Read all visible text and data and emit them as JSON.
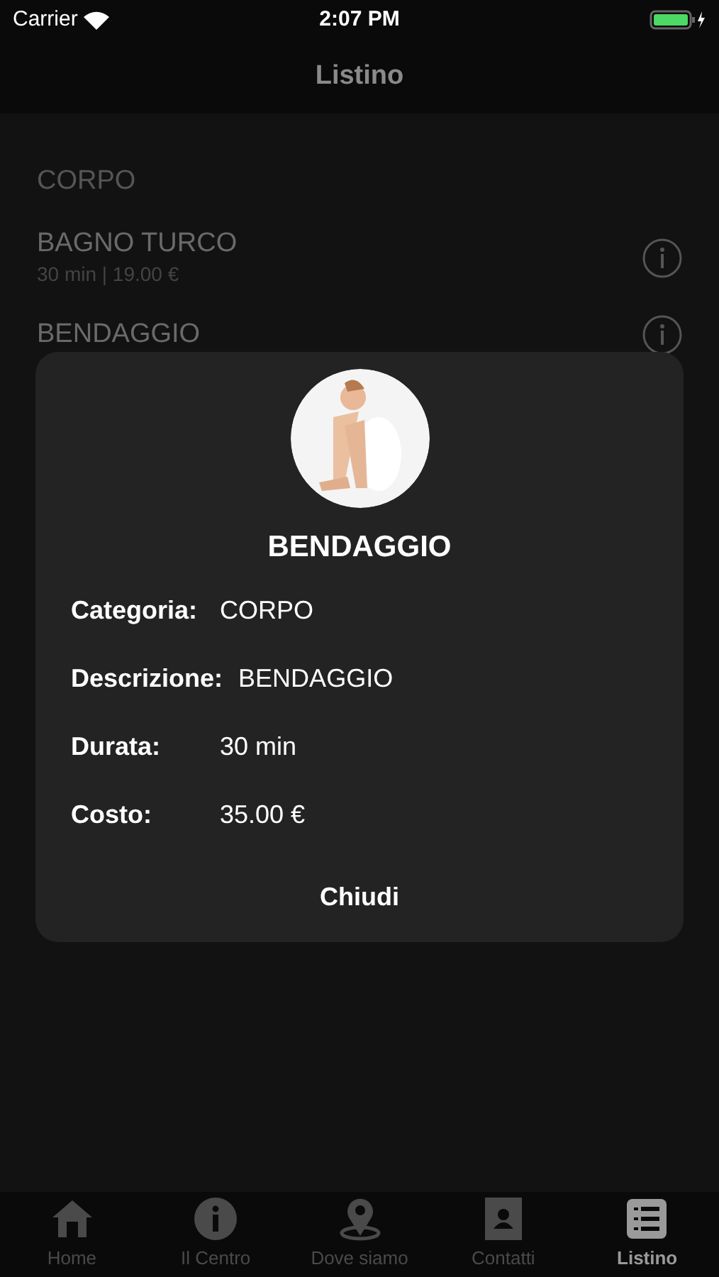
{
  "status_bar": {
    "carrier": "Carrier",
    "time": "2:07 PM"
  },
  "nav": {
    "title": "Listino"
  },
  "section": {
    "title": "CORPO"
  },
  "items": [
    {
      "name": "BAGNO TURCO",
      "detail": "30 min | 19.00 €"
    },
    {
      "name": "BENDAGGIO"
    }
  ],
  "dialog": {
    "title": "BENDAGGIO",
    "fields": [
      {
        "label": "Categoria:",
        "value": "CORPO"
      },
      {
        "label": "Descrizione:",
        "value": "BENDAGGIO"
      },
      {
        "label": "Durata:",
        "value": "30 min"
      },
      {
        "label": "Costo:",
        "value": "35.00 €"
      }
    ],
    "close": "Chiudi"
  },
  "tabs": [
    {
      "kind": "home",
      "label": "Home",
      "selected": false
    },
    {
      "kind": "info",
      "label": "Il Centro",
      "selected": false
    },
    {
      "kind": "pin",
      "label": "Dove siamo",
      "selected": false
    },
    {
      "kind": "contact",
      "label": "Contatti",
      "selected": false
    },
    {
      "kind": "list",
      "label": "Listino",
      "selected": true
    }
  ]
}
